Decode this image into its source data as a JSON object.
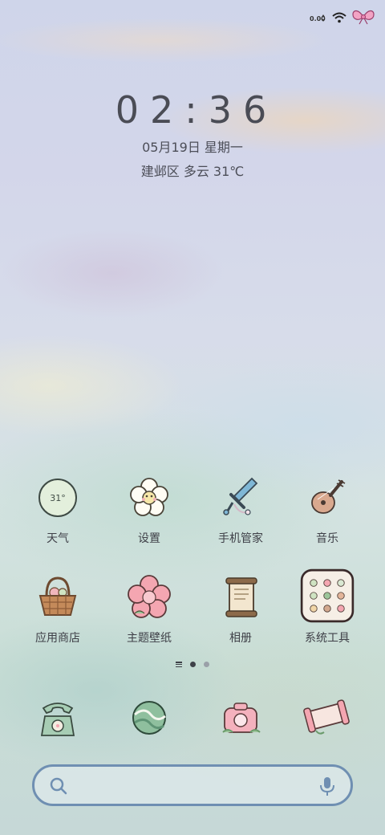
{
  "status_bar": {
    "net_speed": "0.00",
    "icons": [
      "data-speed-icon",
      "wifi-icon",
      "bow-battery-icon"
    ]
  },
  "clock": {
    "time": "02:36",
    "date": "05月19日 星期一",
    "weather": "建邺区 多云 31℃"
  },
  "apps_row1": [
    {
      "label": "天气",
      "icon": "weather-icon",
      "badge": "31°"
    },
    {
      "label": "设置",
      "icon": "flower-settings-icon"
    },
    {
      "label": "手机管家",
      "icon": "sword-manager-icon"
    },
    {
      "label": "音乐",
      "icon": "pipa-music-icon"
    }
  ],
  "apps_row2": [
    {
      "label": "应用商店",
      "icon": "basket-store-icon"
    },
    {
      "label": "主题壁纸",
      "icon": "pink-flower-theme-icon"
    },
    {
      "label": "相册",
      "icon": "scroll-album-icon"
    },
    {
      "label": "系统工具",
      "icon": "folder-tools-icon"
    }
  ],
  "dock": [
    {
      "icon": "phone-icon"
    },
    {
      "icon": "green-orb-icon"
    },
    {
      "icon": "camera-icon"
    },
    {
      "icon": "scroll-messages-icon"
    }
  ],
  "page_indicator": {
    "pages": 2,
    "current": 1
  },
  "colors": {
    "search_border": "#6f8fb2",
    "text": "#4a4c55"
  }
}
